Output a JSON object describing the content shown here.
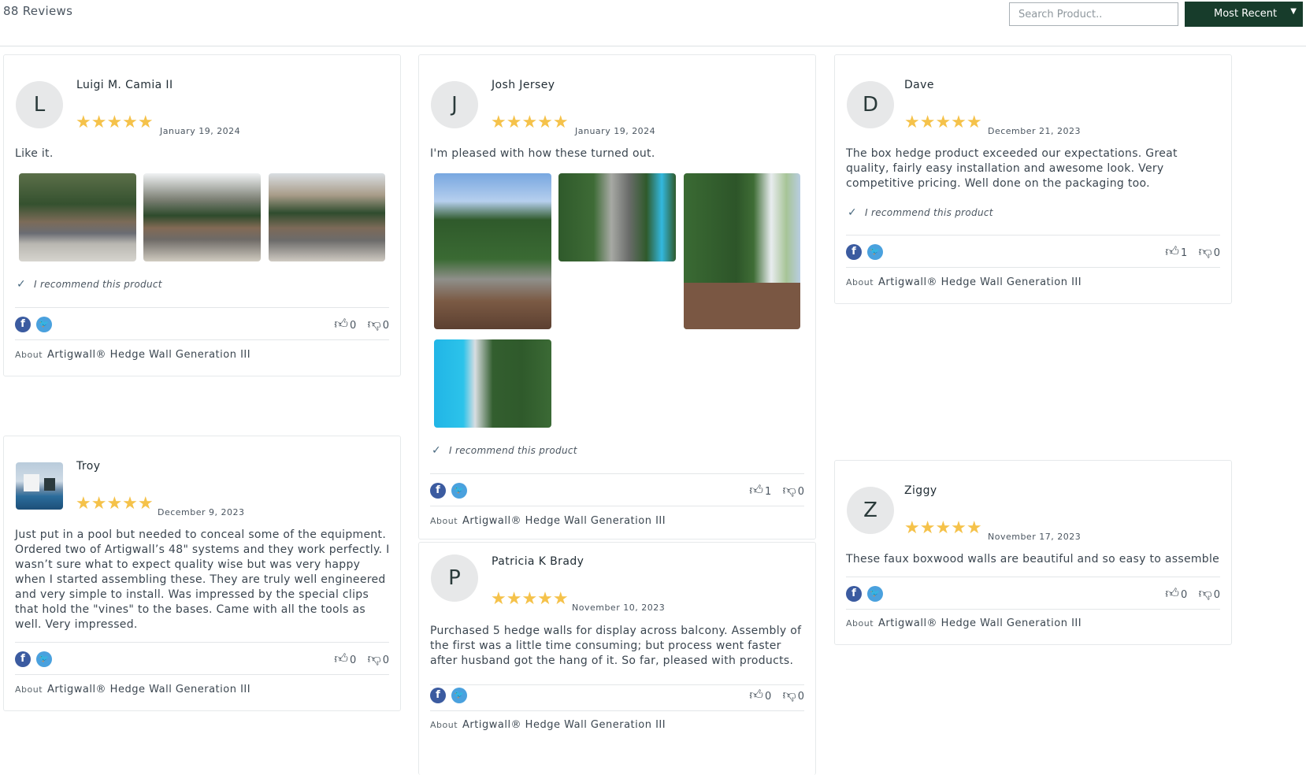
{
  "header": {
    "review_count": "88 Reviews",
    "search_placeholder": "Search Product..",
    "sort_label": "Most Recent"
  },
  "colors": {
    "accent": "#173c2b",
    "star": "#f5c24a",
    "facebook": "#3b5ba0",
    "twitter": "#4aa1de"
  },
  "reviews": [
    {
      "initial": "L",
      "name": "Luigi M. Camia II",
      "rating": 5,
      "stars": "★★★★★",
      "date": "January 19, 2024",
      "text": "Like it.",
      "recommend": "I recommend this product",
      "up": "0",
      "down": "0",
      "about_label": "About",
      "product": "Artigwall® Hedge Wall Generation III"
    },
    {
      "initial": "J",
      "name": "Josh Jersey",
      "rating": 5,
      "stars": "★★★★★",
      "date": "January 19, 2024",
      "text": "I'm pleased with how these turned out.",
      "recommend": "I recommend this product",
      "up": "1",
      "down": "0",
      "about_label": "About",
      "product": "Artigwall® Hedge Wall Generation III"
    },
    {
      "initial": "D",
      "name": "Dave",
      "rating": 5,
      "stars": "★★★★★",
      "date": "December 21, 2023",
      "text": "The box hedge product exceeded our expectations. Great quality, fairly easy installation and awesome look. Very competitive pricing. Well done on the packaging too.",
      "recommend": "I recommend this product",
      "up": "1",
      "down": "0",
      "about_label": "About",
      "product": "Artigwall® Hedge Wall Generation III"
    },
    {
      "initial": "",
      "name": "Troy",
      "rating": 5,
      "stars": "★★★★★",
      "date": "December 9, 2023",
      "text": "Just put in a pool but needed to conceal some of the equipment. Ordered two of Artigwall’s 48\" systems and they work perfectly. I wasn’t sure what to expect quality wise but was very happy when I started assembling these. They are truly well engineered and very simple to install. Was impressed by the special clips that hold the \"vines\" to the bases. Came with all the tools as well. Very impressed.",
      "up": "0",
      "down": "0",
      "about_label": "About",
      "product": "Artigwall® Hedge Wall Generation III"
    },
    {
      "initial": "P",
      "name": "Patricia K Brady",
      "rating": 5,
      "stars": "★★★★★",
      "date": "November 10, 2023",
      "text": "Purchased 5 hedge walls for display across balcony. Assembly of the first was a little time consuming; but process went faster after husband got the hang of it. So far, pleased with products.",
      "up": "0",
      "down": "0",
      "about_label": "About",
      "product": "Artigwall® Hedge Wall Generation III"
    },
    {
      "initial": "Z",
      "name": "Ziggy",
      "rating": 5,
      "stars": "★★★★★",
      "date": "November 17, 2023",
      "text": "These faux boxwood walls are beautiful and so easy to assemble",
      "up": "0",
      "down": "0",
      "about_label": "About",
      "product": "Artigwall® Hedge Wall Generation III"
    }
  ]
}
